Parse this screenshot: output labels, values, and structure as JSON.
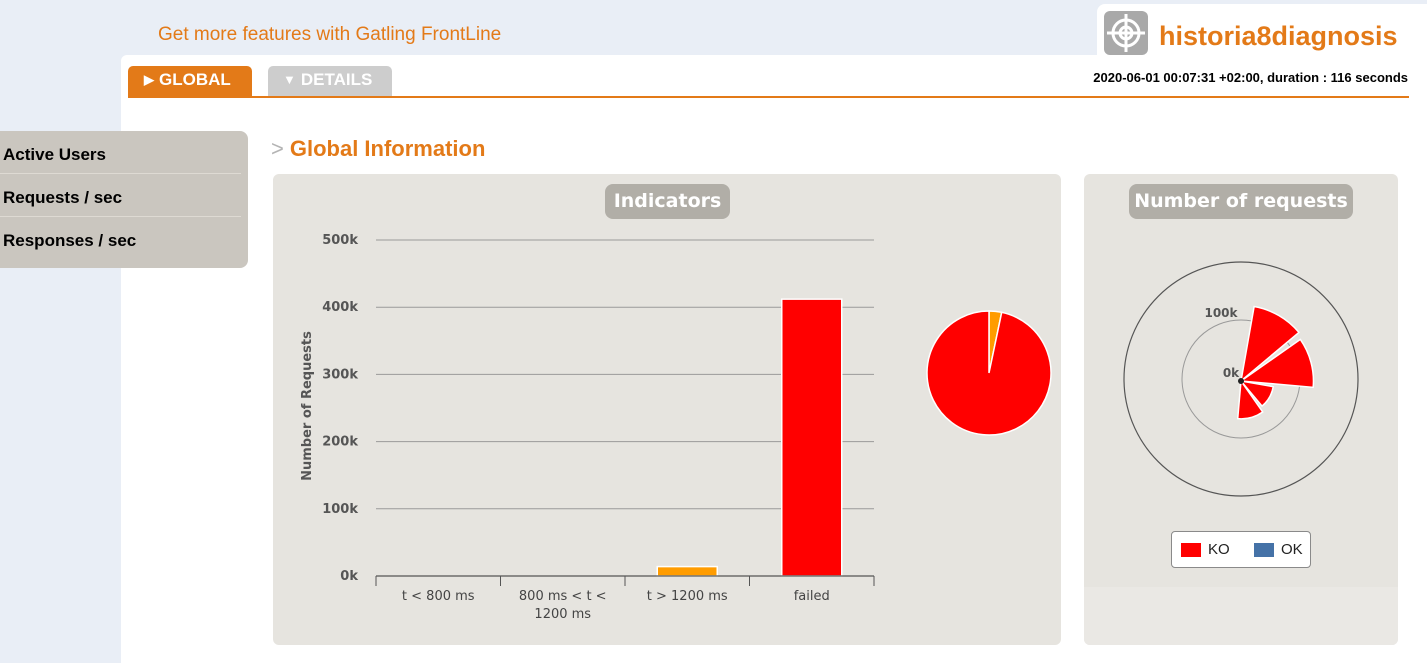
{
  "promo_text": "Get more features with Gatling FrontLine",
  "brand": {
    "name": "historia8diagnosis",
    "logo_icon": "crosshair-icon"
  },
  "tabs": [
    {
      "label": "GLOBAL",
      "icon": "triangle-right-icon",
      "active": true
    },
    {
      "label": "DETAILS",
      "icon": "triangle-down-icon",
      "active": false
    }
  ],
  "run_info": "2020-06-01 00:07:31 +02:00, duration : 116 seconds",
  "sidebar": {
    "items": [
      {
        "label": "Active Users"
      },
      {
        "label": "Requests / sec"
      },
      {
        "label": "Responses / sec"
      }
    ]
  },
  "section_title": "Global Information",
  "section_marker": ">",
  "colors": {
    "accent": "#e37a18",
    "ko": "#ff0000",
    "ok": "#4572a7",
    "orange_bar": "#ff9c00"
  },
  "chart_data": [
    {
      "type": "bar",
      "title": "Indicators",
      "ylabel": "Number of Requests",
      "categories": [
        "t < 800 ms",
        "800 ms < t < 1200 ms",
        "t > 1200 ms",
        "failed"
      ],
      "category_lines": [
        [
          "t < 800 ms"
        ],
        [
          "800 ms < t <",
          "1200 ms"
        ],
        [
          "t > 1200 ms"
        ],
        [
          "failed"
        ]
      ],
      "values": [
        0,
        0,
        14000,
        412000
      ],
      "bar_colors": [
        "#4572a7",
        "#ffdd00",
        "#ff9c00",
        "#ff0000"
      ],
      "yticks": [
        "0k",
        "100k",
        "200k",
        "300k",
        "400k",
        "500k"
      ],
      "ylim": [
        0,
        500000
      ],
      "grid": true
    },
    {
      "type": "pie",
      "slices": [
        {
          "label": "failed",
          "value": 412000,
          "color": "#ff0000"
        },
        {
          "label": "t > 1200 ms",
          "value": 14000,
          "color": "#ff9c00"
        }
      ]
    },
    {
      "type": "polar",
      "title": "Number of requests",
      "radial_ticks": [
        "0k",
        "100k"
      ],
      "legend": [
        {
          "label": "KO",
          "color": "#ff0000"
        },
        {
          "label": "OK",
          "color": "#4572a7"
        }
      ],
      "sectors": [
        {
          "value": 120000
        },
        {
          "value": 115000
        },
        {
          "value": 52000
        },
        {
          "value": 60000
        }
      ]
    }
  ]
}
